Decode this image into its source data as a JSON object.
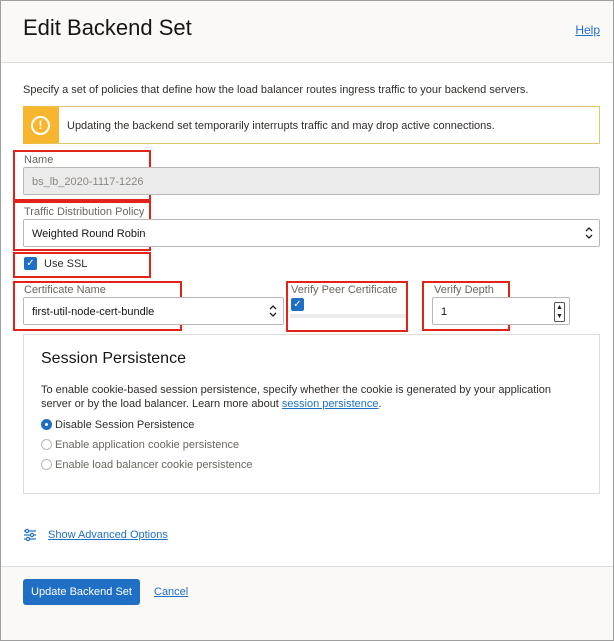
{
  "header": {
    "title": "Edit Backend Set",
    "help_label": "Help"
  },
  "intro_text": "Specify a set of policies that define how the load balancer routes ingress traffic to your backend servers.",
  "warning": {
    "icon": "warning-icon",
    "text": "Updating the backend set temporarily interrupts traffic and may drop active connections."
  },
  "name": {
    "label": "Name",
    "value": "bs_lb_2020-1117-1226"
  },
  "policy": {
    "label": "Traffic Distribution Policy",
    "value": "Weighted Round Robin"
  },
  "use_ssl": {
    "label": "Use SSL",
    "checked": true
  },
  "certificate": {
    "label": "Certificate Name",
    "value": "first-util-node-cert-bundle"
  },
  "verify_peer": {
    "label": "Verify Peer Certificate",
    "checked": true
  },
  "verify_depth": {
    "label": "Verify Depth",
    "value": "1"
  },
  "session": {
    "title": "Session Persistence",
    "desc_prefix": "To enable cookie-based session persistence, specify whether the cookie is generated by your application server or by the load balancer. Learn more about ",
    "desc_link": "session persistence",
    "desc_suffix": ".",
    "options": [
      {
        "label": "Disable Session Persistence",
        "selected": true
      },
      {
        "label": "Enable application cookie persistence",
        "selected": false
      },
      {
        "label": "Enable load balancer cookie persistence",
        "selected": false
      }
    ]
  },
  "advanced": {
    "label": "Show Advanced Options",
    "icon": "sliders-icon"
  },
  "footer": {
    "submit_label": "Update Backend Set",
    "cancel_label": "Cancel"
  },
  "colors": {
    "accent": "#1f6fc5",
    "warning": "#f8b52e",
    "highlight": "#e2231a"
  }
}
